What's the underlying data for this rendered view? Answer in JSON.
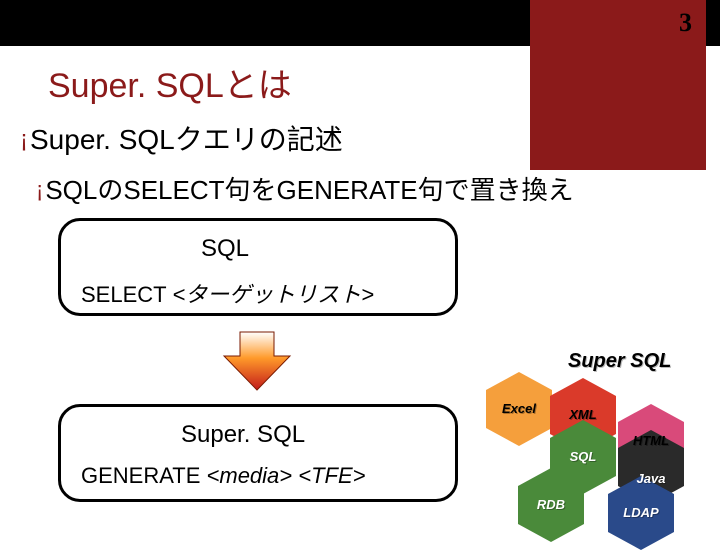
{
  "page_number": "3",
  "title": "Super. SQLとは",
  "bullet": "Super. SQLクエリの記述",
  "sub_bullet": "SQLのSELECT句をGENERATE句で置き換え",
  "box_sql": {
    "label": "SQL",
    "stmt_prefix": "SELECT ",
    "stmt_arg": "<ターゲットリスト>"
  },
  "box_super": {
    "label": "Super. SQL",
    "stmt_prefix": "GENERATE ",
    "stmt_arg": "<media> <TFE>"
  },
  "honeycomb": {
    "title": "Super SQL",
    "cells": {
      "excel": "Excel",
      "xml": "XML",
      "sql": "SQL",
      "html": "HTML",
      "java": "Java",
      "rdb": "RDB",
      "ldap": "LDAP"
    }
  }
}
